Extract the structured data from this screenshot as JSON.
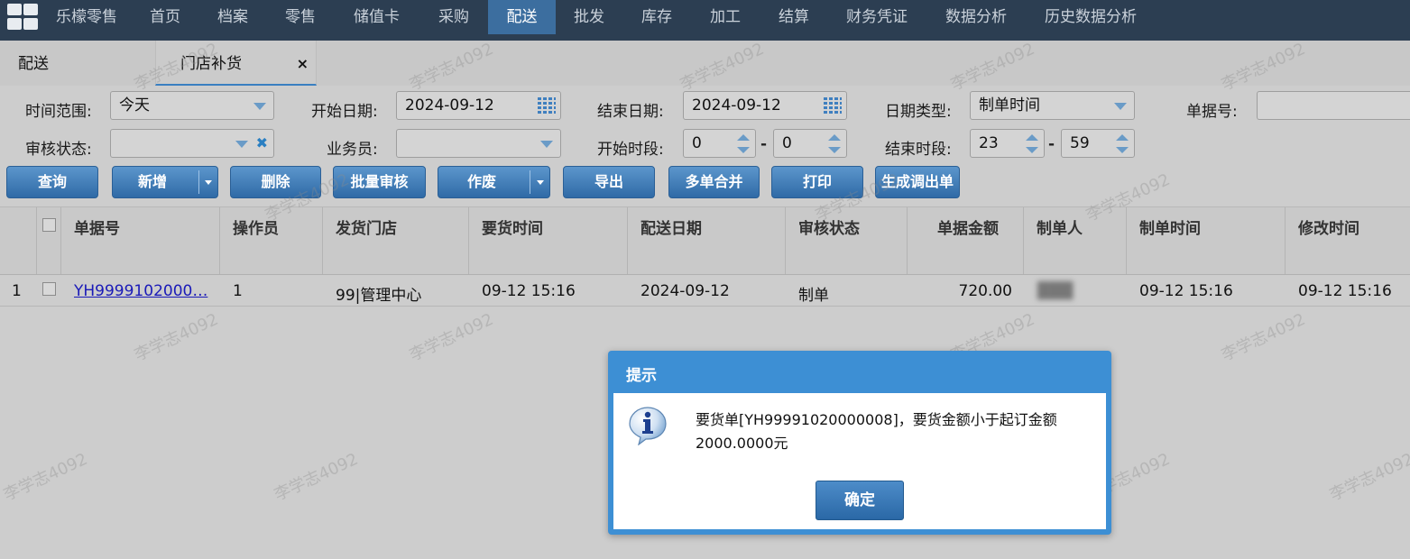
{
  "nav": {
    "items": [
      "乐檬零售",
      "首页",
      "档案",
      "零售",
      "储值卡",
      "采购",
      "配送",
      "批发",
      "库存",
      "加工",
      "结算",
      "财务凭证",
      "数据分析",
      "历史数据分析"
    ],
    "active": "配送"
  },
  "tabs": [
    "配送",
    "门店补货"
  ],
  "tab_close": "×",
  "form": {
    "time_range_label": "时间范围:",
    "time_range_value": "今天",
    "start_date_label": "开始日期:",
    "start_date_value": "2024-09-12",
    "end_date_label": "结束日期:",
    "end_date_value": "2024-09-12",
    "date_type_label": "日期类型:",
    "date_type_value": "制单时间",
    "doc_no_label": "单据号:",
    "doc_no_value": "",
    "audit_status_label": "审核状态:",
    "audit_status_value": "",
    "salesman_label": "业务员:",
    "salesman_value": "",
    "start_period_label": "开始时段:",
    "start_period_from": "0",
    "start_period_to": "0",
    "end_period_label": "结束时段:",
    "end_period_from": "23",
    "end_period_to": "59",
    "dash": "-"
  },
  "buttons": [
    "查询",
    "新增",
    "删除",
    "批量审核",
    "作废",
    "导出",
    "多单合并",
    "打印",
    "生成调出单"
  ],
  "table": {
    "headers": [
      "单据号",
      "操作员",
      "发货门店",
      "要货时间",
      "配送日期",
      "审核状态",
      "单据金额",
      "制单人",
      "制单时间",
      "修改时间"
    ],
    "rows": [
      {
        "index": "1",
        "doc_no": "YH9999102000…",
        "operator": "1",
        "store": "99|管理中心",
        "request_time": "09-12 15:16",
        "delivery_date": "2024-09-12",
        "status": "制单",
        "amount": "720.00",
        "creator": "███",
        "created": "09-12 15:16",
        "modified": "09-12 15:16"
      }
    ]
  },
  "watermark": "李学志4092",
  "dialog": {
    "title": "提示",
    "message": "要货单[YH99991020000008]，要货金额小于起订金额2000.0000元",
    "ok": "确定",
    "icon": "info-icon"
  },
  "colors": {
    "nav_bg": "#2c3e52",
    "nav_active": "#3c6e9f",
    "button": "#3a78b6",
    "dialog_header": "#3d8fd4",
    "link": "#1a1ab8"
  }
}
